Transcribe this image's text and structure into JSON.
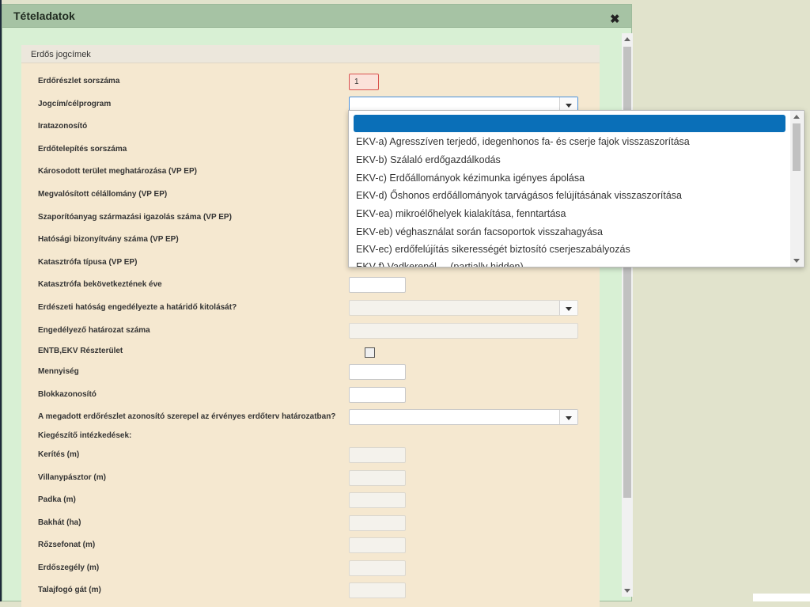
{
  "dialog": {
    "title": "Tételadatok",
    "close_icon": "close-icon"
  },
  "section": {
    "title": "Erdős jogcímek"
  },
  "fields": {
    "erdoreszlet_sorszama": {
      "label": "Erdőrészlet sorszáma",
      "value": "1"
    },
    "jogcim": {
      "label": "Jogcím/célprogram",
      "value": ""
    },
    "iratazonosito": {
      "label": "Iratazonosító"
    },
    "erdotelepites_sorszama": {
      "label": "Erdőtelepítés sorszáma"
    },
    "karosodott_terulet": {
      "label": "Károsodott terület meghatározása (VP EP)"
    },
    "megvalositott_celallomany": {
      "label": "Megvalósított célállomány (VP EP)"
    },
    "szaporitoanyag": {
      "label": "Szaporítóanyag származási igazolás száma (VP EP)"
    },
    "hatosagi_bizonyitvany": {
      "label": "Hatósági bizonyítvány száma (VP EP)"
    },
    "katasztrofa_tipusa": {
      "label": "Katasztrófa típusa (VP EP)"
    },
    "katasztrofa_eve": {
      "label": "Katasztrófa bekövetkeztének éve",
      "value": ""
    },
    "hatarido_kitolas": {
      "label": "Erdészeti hatóság engedélyezte a határidő kitolását?",
      "value": ""
    },
    "engedelyezo_hatarozat": {
      "label": "Engedélyező határozat száma",
      "value": ""
    },
    "entb_ekv": {
      "label": "ENTB,EKV Részterület",
      "checked": false
    },
    "mennyiseg": {
      "label": "Mennyiség",
      "value": ""
    },
    "blokkazonosito": {
      "label": "Blokkazonosító",
      "value": ""
    },
    "erdoterv_hatarozat": {
      "label": "A megadott erdőrészlet azonosító szerepel az érvényes erdőterv határozatban?",
      "value": ""
    },
    "kiegeszito": {
      "label": "Kiegészítő intézkedések:"
    },
    "kerites": {
      "label": "Kerítés (m)",
      "value": ""
    },
    "villanypasztor": {
      "label": "Villanypásztor (m)",
      "value": ""
    },
    "padka": {
      "label": "Padka (m)",
      "value": ""
    },
    "bakhat": {
      "label": "Bakhát (ha)",
      "value": ""
    },
    "rozsefonat": {
      "label": "Rőzsefonat (m)",
      "value": ""
    },
    "erdoszegely": {
      "label": "Erdőszegély (m)",
      "value": ""
    },
    "talajfogo_gat": {
      "label": "Talajfogó gát (m)",
      "value": ""
    }
  },
  "dropdown": {
    "selected_label": "",
    "options": [
      "EKV-a) Agresszíven terjedő, idegenhonos fa- és cserje fajok visszaszorítása",
      "EKV-b) Szálaló erdőgazdálkodás",
      "EKV-c) Erdőállományok kézimunka igényes ápolása",
      "EKV-d) Őshonos erdőállományok tarvágásos felújításának visszaszorítása",
      "EKV-ea) mikroélőhelyek kialakítása, fenntartása",
      "EKV-eb) véghasználat során facsoportok visszahagyása",
      "EKV-ec) erdőfelújítás sikerességét biztosító cserjeszabályozás",
      "EKV-f) Vadkerenél.....(partially hidden)"
    ]
  },
  "colors": {
    "dialog_bg": "#d8f0d4",
    "titlebar_bg": "#a6c3a4",
    "panel_bg": "#f5e8d0",
    "selected_option": "#0a6fb8",
    "error_border": "#d9534f"
  }
}
